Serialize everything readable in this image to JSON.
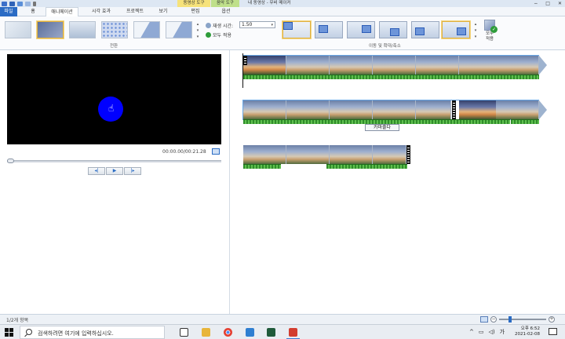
{
  "window": {
    "title": "내 동영상 - 무비 메이커",
    "context_tab_video": "동영상 도구",
    "context_tab_music": "음악 도구",
    "controls": [
      "−",
      "□",
      "✕"
    ]
  },
  "tabs": [
    "파일",
    "홈",
    "애니메이션",
    "시각 효과",
    "프로젝트",
    "보기",
    "편집",
    "옵션"
  ],
  "ribbon": {
    "transitions_group_label": "전환",
    "duration_label": "재생 시간:",
    "duration_value": "1.50",
    "apply_all_label": "모두 적용",
    "pan_zoom_group_label": "이동 및 확대/축소",
    "apply_all_big_label_1": "모두",
    "apply_all_big_label_2": "적용"
  },
  "preview": {
    "time": "00:00.00/00:21.28",
    "prev_frame": "◂|",
    "play": "▶",
    "next_frame": "|▸"
  },
  "storyboard": {
    "caption_button": "카마줄다"
  },
  "status": {
    "items_text": "1/2개 항목",
    "zoom_minus": "−",
    "zoom_plus": "+"
  },
  "taskbar": {
    "search_placeholder": "검색하려면 여기에 입력하십시오.",
    "tray_text": "오후",
    "ime": "가",
    "time": "오후 6:52",
    "date": "2021-02-08"
  },
  "colors": {
    "accent": "#2a6bc4",
    "cursor_highlight": "#0000ff",
    "audio_green": "#2f8d2a"
  }
}
